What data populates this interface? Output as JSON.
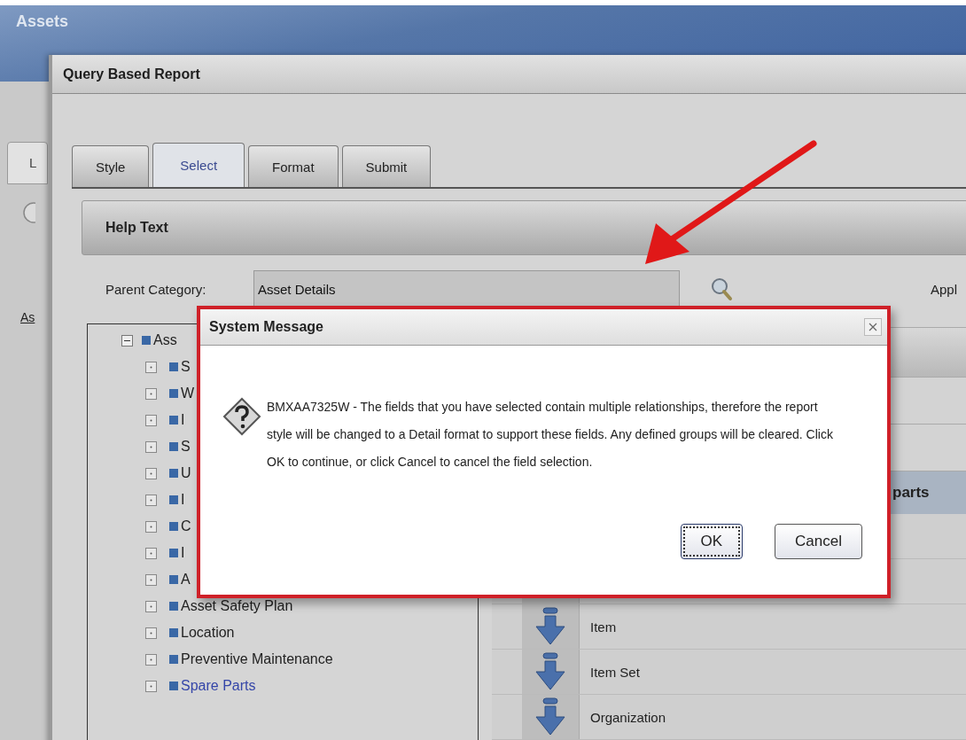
{
  "app": {
    "title": "Assets",
    "background_tab": "L",
    "background_link": "As"
  },
  "report_window": {
    "title": "Query Based Report",
    "tabs": [
      {
        "label": "Style",
        "selected": false
      },
      {
        "label": "Select",
        "selected": true
      },
      {
        "label": "Format",
        "selected": false
      },
      {
        "label": "Submit",
        "selected": false
      }
    ],
    "section_title": "Help Text",
    "parent_category": {
      "label": "Parent Category:",
      "value": "Asset Details"
    },
    "right_label": "Appl",
    "tree": {
      "label": "Ass",
      "expanded": true,
      "selected": false,
      "children": [
        {
          "label": "S",
          "expanded": false,
          "selected": false
        },
        {
          "label": "W",
          "expanded": false,
          "selected": false
        },
        {
          "label": "I",
          "expanded": false,
          "selected": false
        },
        {
          "label": "S",
          "expanded": false,
          "selected": false
        },
        {
          "label": "U",
          "expanded": false,
          "selected": false
        },
        {
          "label": "I",
          "expanded": false,
          "selected": false
        },
        {
          "label": "C",
          "expanded": false,
          "selected": false
        },
        {
          "label": "I",
          "expanded": false,
          "selected": false
        },
        {
          "label": "A",
          "expanded": false,
          "selected": false
        },
        {
          "label": "Asset Safety Plan",
          "expanded": false,
          "selected": false
        },
        {
          "label": "Location",
          "expanded": false,
          "selected": false
        },
        {
          "label": "Preventive Maintenance",
          "expanded": false,
          "selected": false
        },
        {
          "label": "Spare Parts",
          "expanded": false,
          "selected": true
        }
      ]
    },
    "field_list": {
      "header": "parts",
      "items": [
        "Item",
        "Item Set",
        "Organization"
      ]
    }
  },
  "dialog": {
    "title": "System Message",
    "message": "BMXAA7325W - The fields that you have selected contain multiple relationships, therefore the report style will be changed to a Detail format to support these fields. Any defined groups will be cleared. Click OK to continue, or click Cancel to cancel the field selection.",
    "buttons": [
      {
        "label": "OK",
        "focused": true
      },
      {
        "label": "Cancel",
        "focused": false
      }
    ]
  }
}
